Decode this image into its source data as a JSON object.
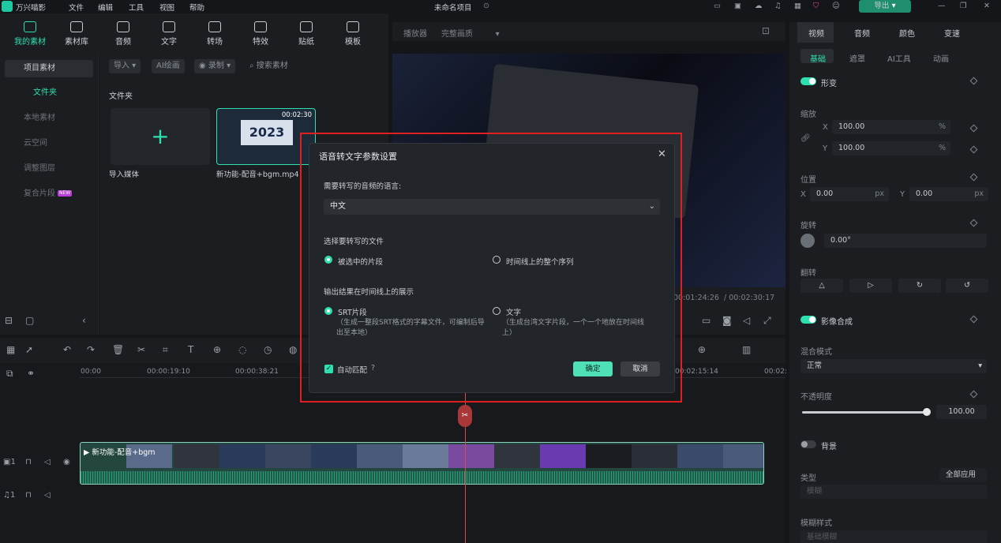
{
  "titlebar": {
    "app_name": "万兴喵影",
    "menus": [
      "文件",
      "编辑",
      "工具",
      "视图",
      "帮助"
    ],
    "project_name": "未命名项目",
    "export_label": "导出"
  },
  "toolbar": {
    "items": [
      {
        "label": "我的素材",
        "icon": "media-icon"
      },
      {
        "label": "素材库",
        "icon": "library-icon"
      },
      {
        "label": "音频",
        "icon": "music-icon"
      },
      {
        "label": "文字",
        "icon": "text-icon"
      },
      {
        "label": "转场",
        "icon": "transition-icon"
      },
      {
        "label": "特效",
        "icon": "effect-icon"
      },
      {
        "label": "贴纸",
        "icon": "sticker-icon"
      },
      {
        "label": "模板",
        "icon": "template-icon"
      }
    ]
  },
  "left_nav": {
    "header": "项目素材",
    "selected": "文件夹",
    "items": [
      "本地素材",
      "云空间",
      "调整图层",
      "复合片段"
    ],
    "new_badge": "NEW"
  },
  "media": {
    "import_label": "导入",
    "ai_label": "AI绘画",
    "record_label": "录制",
    "search_placeholder": "搜索素材",
    "folder_title": "文件夹",
    "import_media_label": "导入媒体",
    "clip_name": "新功能-配音+bgm.mp4",
    "clip_duration": "00:02:30",
    "clip_year": "2023"
  },
  "preview": {
    "player_label": "播放器",
    "quality_label": "完整画质",
    "current_time": "00:01:24:26",
    "total_time": "/ 00:02:30:17"
  },
  "right_panel": {
    "tabs": [
      "视频",
      "音频",
      "颜色",
      "变速"
    ],
    "subtabs": [
      "基础",
      "遮罩",
      "AI工具",
      "动画"
    ],
    "transform_label": "形变",
    "scale_label": "缩放",
    "scale_x": "100.00",
    "scale_y": "100.00",
    "percent": "%",
    "position_label": "位置",
    "pos_x": "0.00",
    "pos_y": "0.00",
    "px": "px",
    "rotate_label": "旋转",
    "rotate_value": "0.00°",
    "flip_label": "翻转",
    "blend_section": "影像合成",
    "blend_mode_label": "混合模式",
    "blend_mode_value": "正常",
    "opacity_label": "不透明度",
    "opacity_value": "100.00",
    "opacity_level": 1.0,
    "background_label": "背景",
    "type_label": "类型",
    "apply_all_label": "全部应用",
    "type_value": "模糊",
    "blur_style_label": "模糊样式",
    "blur_style_value": "基础模糊",
    "axis_x": "X",
    "axis_y": "Y"
  },
  "timeline": {
    "ruler": [
      "00:00",
      "00:00:19:10",
      "00:00:38:21",
      "00:02:15:14",
      "00:02:"
    ],
    "clip_label": "新功能-配音+bgm",
    "track_video_num": "1",
    "track_audio_num": "1"
  },
  "dialog": {
    "title": "语音转文字参数设置",
    "language_question": "需要转写的音频的语言:",
    "language_value": "中文",
    "file_section": "选择要转写的文件",
    "option_selected_clip": "被选中的片段",
    "option_full_sequence": "时间线上的整个序列",
    "output_section": "输出结果在时间线上的展示",
    "option_srt": "SRT片段",
    "option_srt_note": "（生成一整段SRT格式的字幕文件，可编制后导出至本地）",
    "option_text": "文字",
    "option_text_note": "（生成台湾文字片段，一个一个地放在时间线上）",
    "auto_match_label": "自动匹配",
    "confirm_label": "确定",
    "cancel_label": "取消"
  },
  "colors": {
    "accent": "#2ee0b0",
    "highlight": "#e02020",
    "playhead": "#d94a4a"
  }
}
